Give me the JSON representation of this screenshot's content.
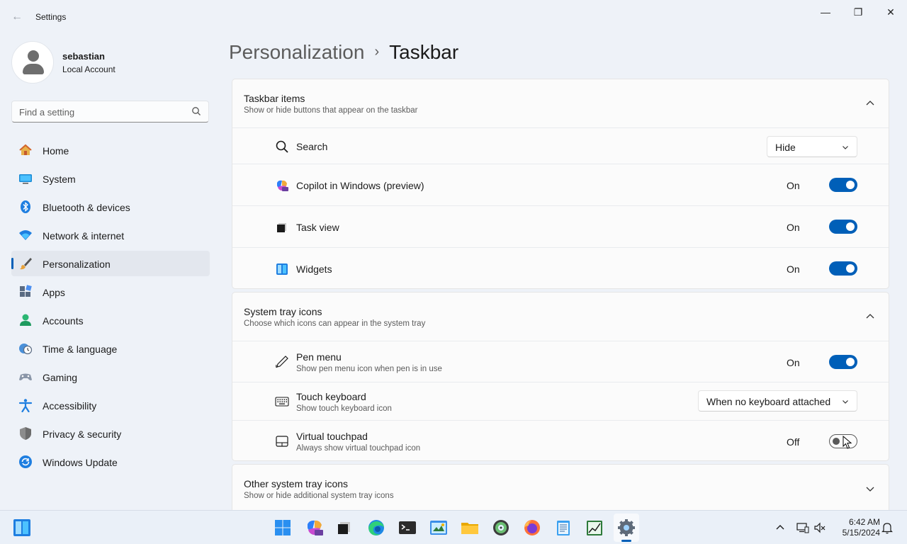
{
  "window": {
    "back_glyph": "←",
    "title": "Settings",
    "minimize_glyph": "—",
    "restore_glyph": "❐",
    "close_glyph": "✕"
  },
  "profile": {
    "name": "sebastian",
    "account_type": "Local Account"
  },
  "search": {
    "placeholder": "Find a setting",
    "icon": "search-icon"
  },
  "nav": {
    "items": [
      {
        "label": "Home",
        "icon": "home-icon",
        "active": false
      },
      {
        "label": "System",
        "icon": "system-icon",
        "active": false
      },
      {
        "label": "Bluetooth & devices",
        "icon": "bluetooth-icon",
        "active": false
      },
      {
        "label": "Network & internet",
        "icon": "wifi-icon",
        "active": false
      },
      {
        "label": "Personalization",
        "icon": "paintbrush-icon",
        "active": true
      },
      {
        "label": "Apps",
        "icon": "apps-icon",
        "active": false
      },
      {
        "label": "Accounts",
        "icon": "accounts-icon",
        "active": false
      },
      {
        "label": "Time & language",
        "icon": "clock-globe-icon",
        "active": false
      },
      {
        "label": "Gaming",
        "icon": "gamepad-icon",
        "active": false
      },
      {
        "label": "Accessibility",
        "icon": "accessibility-icon",
        "active": false
      },
      {
        "label": "Privacy & security",
        "icon": "shield-icon",
        "active": false
      },
      {
        "label": "Windows Update",
        "icon": "update-icon",
        "active": false
      }
    ]
  },
  "breadcrumb": {
    "parent": "Personalization",
    "separator": "›",
    "current": "Taskbar"
  },
  "taskbar_items": {
    "title": "Taskbar items",
    "subtitle": "Show or hide buttons that appear on the taskbar",
    "expanded": true,
    "search": {
      "label": "Search",
      "value": "Hide",
      "icon": "search-icon"
    },
    "copilot": {
      "label": "Copilot in Windows (preview)",
      "state": "On",
      "icon": "copilot-icon"
    },
    "task_view": {
      "label": "Task view",
      "state": "On",
      "icon": "task-view-icon"
    },
    "widgets": {
      "label": "Widgets",
      "state": "On",
      "icon": "widgets-icon"
    }
  },
  "system_tray": {
    "title": "System tray icons",
    "subtitle": "Choose which icons can appear in the system tray",
    "expanded": true,
    "pen_menu": {
      "label": "Pen menu",
      "description": "Show pen menu icon when pen is in use",
      "state": "On",
      "icon": "pen-icon"
    },
    "touch_keyboard": {
      "label": "Touch keyboard",
      "description": "Show touch keyboard icon",
      "value": "When no keyboard attached",
      "icon": "keyboard-icon"
    },
    "virtual_touchpad": {
      "label": "Virtual touchpad",
      "description": "Always show virtual touchpad icon",
      "state": "Off",
      "icon": "touchpad-icon"
    }
  },
  "other_tray": {
    "title": "Other system tray icons",
    "subtitle": "Show or hide additional system tray icons",
    "expanded": false
  },
  "taskbar": {
    "apps": [
      "start-icon",
      "copilot-icon",
      "task-view-icon",
      "edge-icon",
      "terminal-icon",
      "paint-icon",
      "file-explorer-icon",
      "media-icon",
      "firefox-icon",
      "notepad-icon",
      "chart-app-icon",
      "settings-icon"
    ],
    "time": "6:42 AM",
    "date": "5/15/2024"
  },
  "colors": {
    "accent": "#005fb8",
    "background": "#eef2f8",
    "card": "#fbfbfb"
  }
}
